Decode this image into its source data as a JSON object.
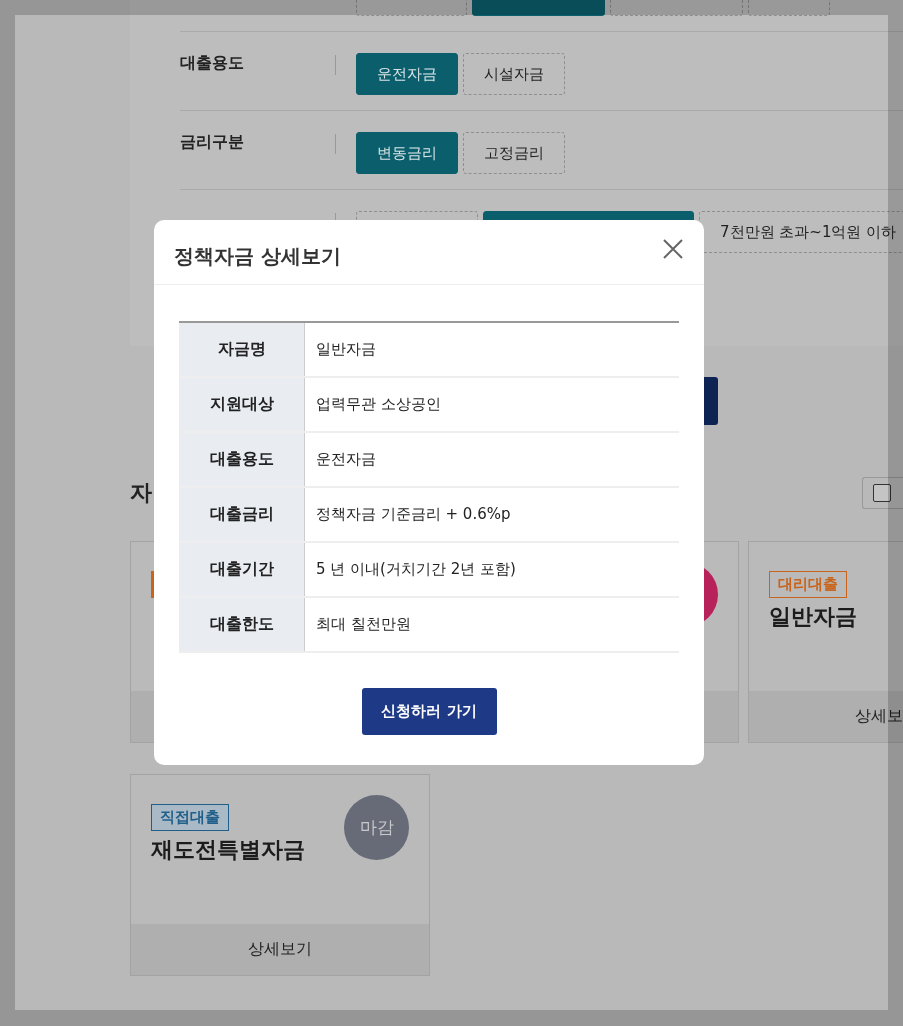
{
  "filters": [
    {
      "options": [
        {
          "selected": false
        },
        {
          "selected": true
        },
        {
          "selected": false
        },
        {
          "selected": false
        }
      ]
    },
    {
      "label": "대출용도",
      "options": [
        {
          "label": "운전자금",
          "selected": true
        },
        {
          "label": "시설자금",
          "selected": false
        }
      ]
    },
    {
      "label": "금리구분",
      "options": [
        {
          "label": "변동금리",
          "selected": true
        },
        {
          "label": "고정금리",
          "selected": false
        }
      ]
    },
    {
      "options": [
        {
          "selected": false
        },
        {
          "selected": true
        },
        {
          "label": "7천만원 초과~1억원 이하",
          "selected": false
        }
      ]
    }
  ],
  "section": {
    "title": "자",
    "select_all": {
      "checked": false
    }
  },
  "cards": [
    {
      "tag": {
        "color": "#c8641c"
      }
    },
    {
      "status": {
        "color": "#b8225a"
      }
    },
    {
      "tag": {
        "color": "#c8641c",
        "label": "대리대출"
      },
      "title": "일반자금",
      "footer": "상세보"
    },
    {
      "tag": {
        "color": "#1f5f8a",
        "label": "직접대출"
      },
      "title": "재도전특별자금",
      "status": {
        "color": "#676a77",
        "label": "마감"
      },
      "footer": "상세보기"
    }
  ],
  "modal": {
    "title": "정책자금 상세보기",
    "rows": [
      {
        "label": "자금명",
        "value": "일반자금"
      },
      {
        "label": "지원대상",
        "value": "업력무관 소상공인"
      },
      {
        "label": "대출용도",
        "value": "운전자금"
      },
      {
        "label": "대출금리",
        "value": "정책자금 기준금리 + 0.6%p"
      },
      {
        "label": "대출기간",
        "value": "5 년 이내(거치기간 2년 포함)"
      },
      {
        "label": "대출한도",
        "value": "최대 칠천만원"
      }
    ],
    "button": "신청하러 가기"
  }
}
